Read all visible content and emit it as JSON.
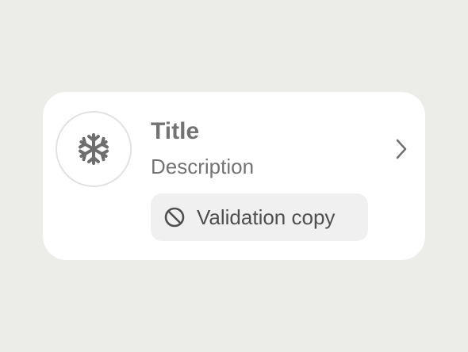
{
  "card": {
    "icon": "snowflake-icon",
    "title": "Title",
    "description": "Description",
    "trailing_icon": "chevron-right-icon",
    "validation": {
      "icon": "ban-icon",
      "text": "Validation copy"
    }
  },
  "colors": {
    "background": "#ECEDE9",
    "card": "#FFFFFF",
    "text_primary": "#737373",
    "chip_background": "#F0F0F0",
    "chip_text": "#4F4F4F",
    "icon": "#6E6E6E"
  }
}
